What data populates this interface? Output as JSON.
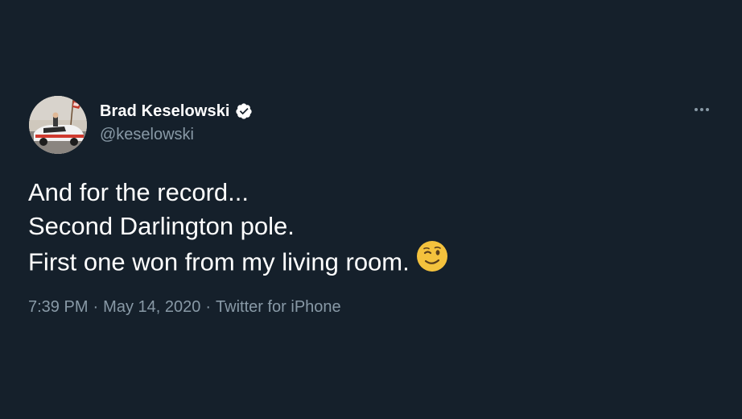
{
  "user": {
    "display_name": "Brad Keselowski",
    "handle": "@keselowski",
    "verified": true,
    "avatar_icon": "avatar-race-car-photo"
  },
  "tweet": {
    "lines": [
      "And for the record...",
      "Second Darlington pole.",
      "First one won from my living room."
    ],
    "emoji": "winking-face",
    "time": "7:39 PM",
    "date": "May 14, 2020",
    "source": "Twitter for iPhone",
    "separator": "·"
  },
  "icons": {
    "verified": "verified-badge-icon",
    "more": "more-options-icon"
  },
  "colors": {
    "background": "#15202b",
    "primary_text": "#ffffff",
    "secondary_text": "#8899a6",
    "emoji_yellow": "#f4c23d"
  }
}
